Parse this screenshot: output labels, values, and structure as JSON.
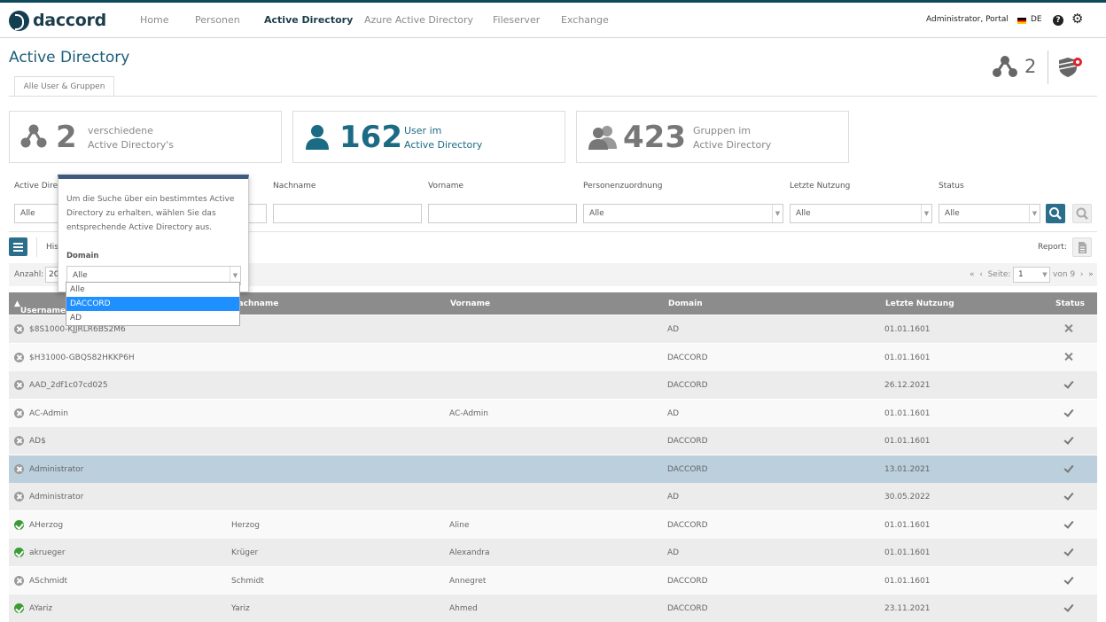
{
  "brand": "daccord",
  "nav": {
    "items": [
      "Home",
      "Personen",
      "Active Directory",
      "Azure Active Directory",
      "Fileserver",
      "Exchange"
    ],
    "active": "Active Directory",
    "user": "Administrator, Portal",
    "lang": "DE",
    "help_glyph": "?"
  },
  "page": {
    "title": "Active Directory",
    "tab": "Alle User & Gruppen",
    "header_count": "2",
    "shield_badge_color": "#e0202a"
  },
  "cards": [
    {
      "num": "2",
      "line1": "verschiedene",
      "line2": "Active Directory's",
      "icon": "network-icon"
    },
    {
      "num": "162",
      "line1": "User im",
      "line2": "Active Directory",
      "icon": "user-icon"
    },
    {
      "num": "423",
      "line1": "Gruppen im",
      "line2": "Active Directory",
      "icon": "group-icon"
    }
  ],
  "filters": {
    "labels": {
      "active_dir": "Active Directory",
      "nachname": "Nachname",
      "vorname": "Vorname",
      "personenzuordnung": "Personenzuordnung",
      "letzte_nutzung": "Letzte Nutzung",
      "status": "Status"
    },
    "active_dir_value": "Alle",
    "personenzuordnung_value": "Alle",
    "letzte_nutzung_value": "Alle",
    "status_value": "Alle"
  },
  "toolbar": {
    "historie": "Historie",
    "report": "Report:"
  },
  "pager": {
    "anzahl_label": "Anzahl:",
    "anzahl_value": "20",
    "seite_label": "Seite:",
    "seite_value": "1",
    "von": "von 9"
  },
  "popover": {
    "text": "Um die Suche über ein bestimmtes Active Directory zu erhalten, wählen Sie das entsprechende Active Directory aus.",
    "domain_label": "Domain",
    "domain_value": "Alle",
    "options": [
      "Alle",
      "DACCORD",
      "AD"
    ],
    "highlighted": "DACCORD"
  },
  "table": {
    "headers": [
      "Username",
      "Nachname",
      "Vorname",
      "Domain",
      "Letzte Nutzung",
      "Status"
    ],
    "rows": [
      {
        "user": "$8S1000-KJJRLR6BS2M6",
        "nachname": "",
        "vorname": "",
        "domain": "AD",
        "last": "01.01.1601",
        "state": "x",
        "status": "cross"
      },
      {
        "user": "$H31000-GBQS82HKKP6H",
        "nachname": "",
        "vorname": "",
        "domain": "DACCORD",
        "last": "01.01.1601",
        "state": "x",
        "status": "cross"
      },
      {
        "user": "AAD_2df1c07cd025",
        "nachname": "",
        "vorname": "",
        "domain": "DACCORD",
        "last": "26.12.2021",
        "state": "x",
        "status": "check"
      },
      {
        "user": "AC-Admin",
        "nachname": "",
        "vorname": "AC-Admin",
        "domain": "AD",
        "last": "01.01.1601",
        "state": "x",
        "status": "check"
      },
      {
        "user": "AD$",
        "nachname": "",
        "vorname": "",
        "domain": "DACCORD",
        "last": "01.01.1601",
        "state": "x",
        "status": "check"
      },
      {
        "user": "Administrator",
        "nachname": "",
        "vorname": "",
        "domain": "DACCORD",
        "last": "13.01.2021",
        "state": "x",
        "status": "check"
      },
      {
        "user": "Administrator",
        "nachname": "",
        "vorname": "",
        "domain": "AD",
        "last": "30.05.2022",
        "state": "x",
        "status": "check"
      },
      {
        "user": "AHerzog",
        "nachname": "Herzog",
        "vorname": "Aline",
        "domain": "DACCORD",
        "last": "01.01.1601",
        "state": "ok",
        "status": "check"
      },
      {
        "user": "akrueger",
        "nachname": "Krüger",
        "vorname": "Alexandra",
        "domain": "AD",
        "last": "01.01.1601",
        "state": "ok",
        "status": "check"
      },
      {
        "user": "ASchmidt",
        "nachname": "Schmidt",
        "vorname": "Annegret",
        "domain": "DACCORD",
        "last": "01.01.1601",
        "state": "x",
        "status": "check"
      },
      {
        "user": "AYariz",
        "nachname": "Yariz",
        "vorname": "Ahmed",
        "domain": "DACCORD",
        "last": "23.11.2021",
        "state": "ok",
        "status": "check"
      }
    ],
    "selected_row": 5
  }
}
